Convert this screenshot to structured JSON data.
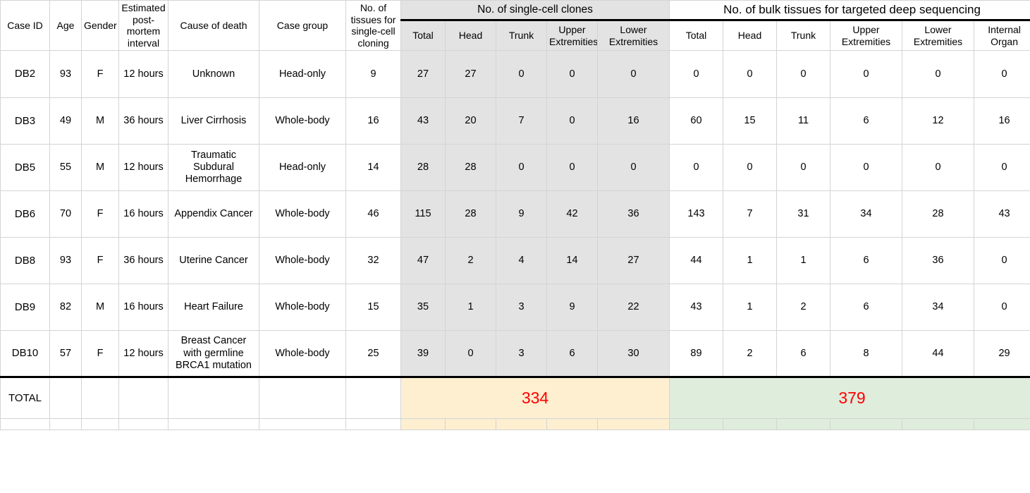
{
  "table": {
    "group_headers": [
      {
        "label": "No. of single-cell clones",
        "span": 5,
        "style": "gray"
      },
      {
        "label": "No. of bulk tissues for targeted deep sequencing",
        "span": 6,
        "style": "plain"
      }
    ],
    "left_headers": [
      "Case ID",
      "Age",
      "Gender",
      "Estimated post-mortem interval",
      "Cause of death",
      "Case group",
      "No. of tissues for single-cell cloning"
    ],
    "singlecell_subheaders": [
      "Total",
      "Head",
      "Trunk",
      "Upper Extremities",
      "Lower Extremities"
    ],
    "bulk_subheaders": [
      "Total",
      "Head",
      "Trunk",
      "Upper Extremities",
      "Lower Extremities",
      "Internal Organ"
    ],
    "rows": [
      {
        "case_id": "DB2",
        "age": "93",
        "gender": "F",
        "pmi": "12 hours",
        "cause": "Unknown",
        "group": "Head-only",
        "tissues": "9",
        "sc": [
          "27",
          "27",
          "0",
          "0",
          "0"
        ],
        "bulk": [
          "0",
          "0",
          "0",
          "0",
          "0",
          "0"
        ]
      },
      {
        "case_id": "DB3",
        "age": "49",
        "gender": "M",
        "pmi": "36 hours",
        "cause": "Liver Cirrhosis",
        "group": "Whole-body",
        "tissues": "16",
        "sc": [
          "43",
          "20",
          "7",
          "0",
          "16"
        ],
        "bulk": [
          "60",
          "15",
          "11",
          "6",
          "12",
          "16"
        ]
      },
      {
        "case_id": "DB5",
        "age": "55",
        "gender": "M",
        "pmi": "12 hours",
        "cause": "Traumatic Subdural Hemorrhage",
        "group": "Head-only",
        "tissues": "14",
        "sc": [
          "28",
          "28",
          "0",
          "0",
          "0"
        ],
        "bulk": [
          "0",
          "0",
          "0",
          "0",
          "0",
          "0"
        ]
      },
      {
        "case_id": "DB6",
        "age": "70",
        "gender": "F",
        "pmi": "16 hours",
        "cause": "Appendix Cancer",
        "group": "Whole-body",
        "tissues": "46",
        "sc": [
          "115",
          "28",
          "9",
          "42",
          "36"
        ],
        "bulk": [
          "143",
          "7",
          "31",
          "34",
          "28",
          "43"
        ]
      },
      {
        "case_id": "DB8",
        "age": "93",
        "gender": "F",
        "pmi": "36 hours",
        "cause": "Uterine Cancer",
        "group": "Whole-body",
        "tissues": "32",
        "sc": [
          "47",
          "2",
          "4",
          "14",
          "27"
        ],
        "bulk": [
          "44",
          "1",
          "1",
          "6",
          "36",
          "0"
        ]
      },
      {
        "case_id": "DB9",
        "age": "82",
        "gender": "M",
        "pmi": "16 hours",
        "cause": "Heart Failure",
        "group": "Whole-body",
        "tissues": "15",
        "sc": [
          "35",
          "1",
          "3",
          "9",
          "22"
        ],
        "bulk": [
          "43",
          "1",
          "2",
          "6",
          "34",
          "0"
        ]
      },
      {
        "case_id": "DB10",
        "age": "57",
        "gender": "F",
        "pmi": "12 hours",
        "cause": "Breast Cancer with germline BRCA1 mutation",
        "group": "Whole-body",
        "tissues": "25",
        "sc": [
          "39",
          "0",
          "3",
          "6",
          "30"
        ],
        "bulk": [
          "89",
          "2",
          "6",
          "8",
          "44",
          "29"
        ]
      }
    ],
    "total_row": {
      "label": "TOTAL",
      "singlecell_total": "334",
      "bulk_total": "379"
    }
  },
  "colors": {
    "group_gray": "#e3e3e3",
    "total_cream": "#fdefd0",
    "total_green": "#dfeddc",
    "total_text_red": "#ff0000",
    "grid_line": "#d4d4d4",
    "rule": "#000000"
  }
}
